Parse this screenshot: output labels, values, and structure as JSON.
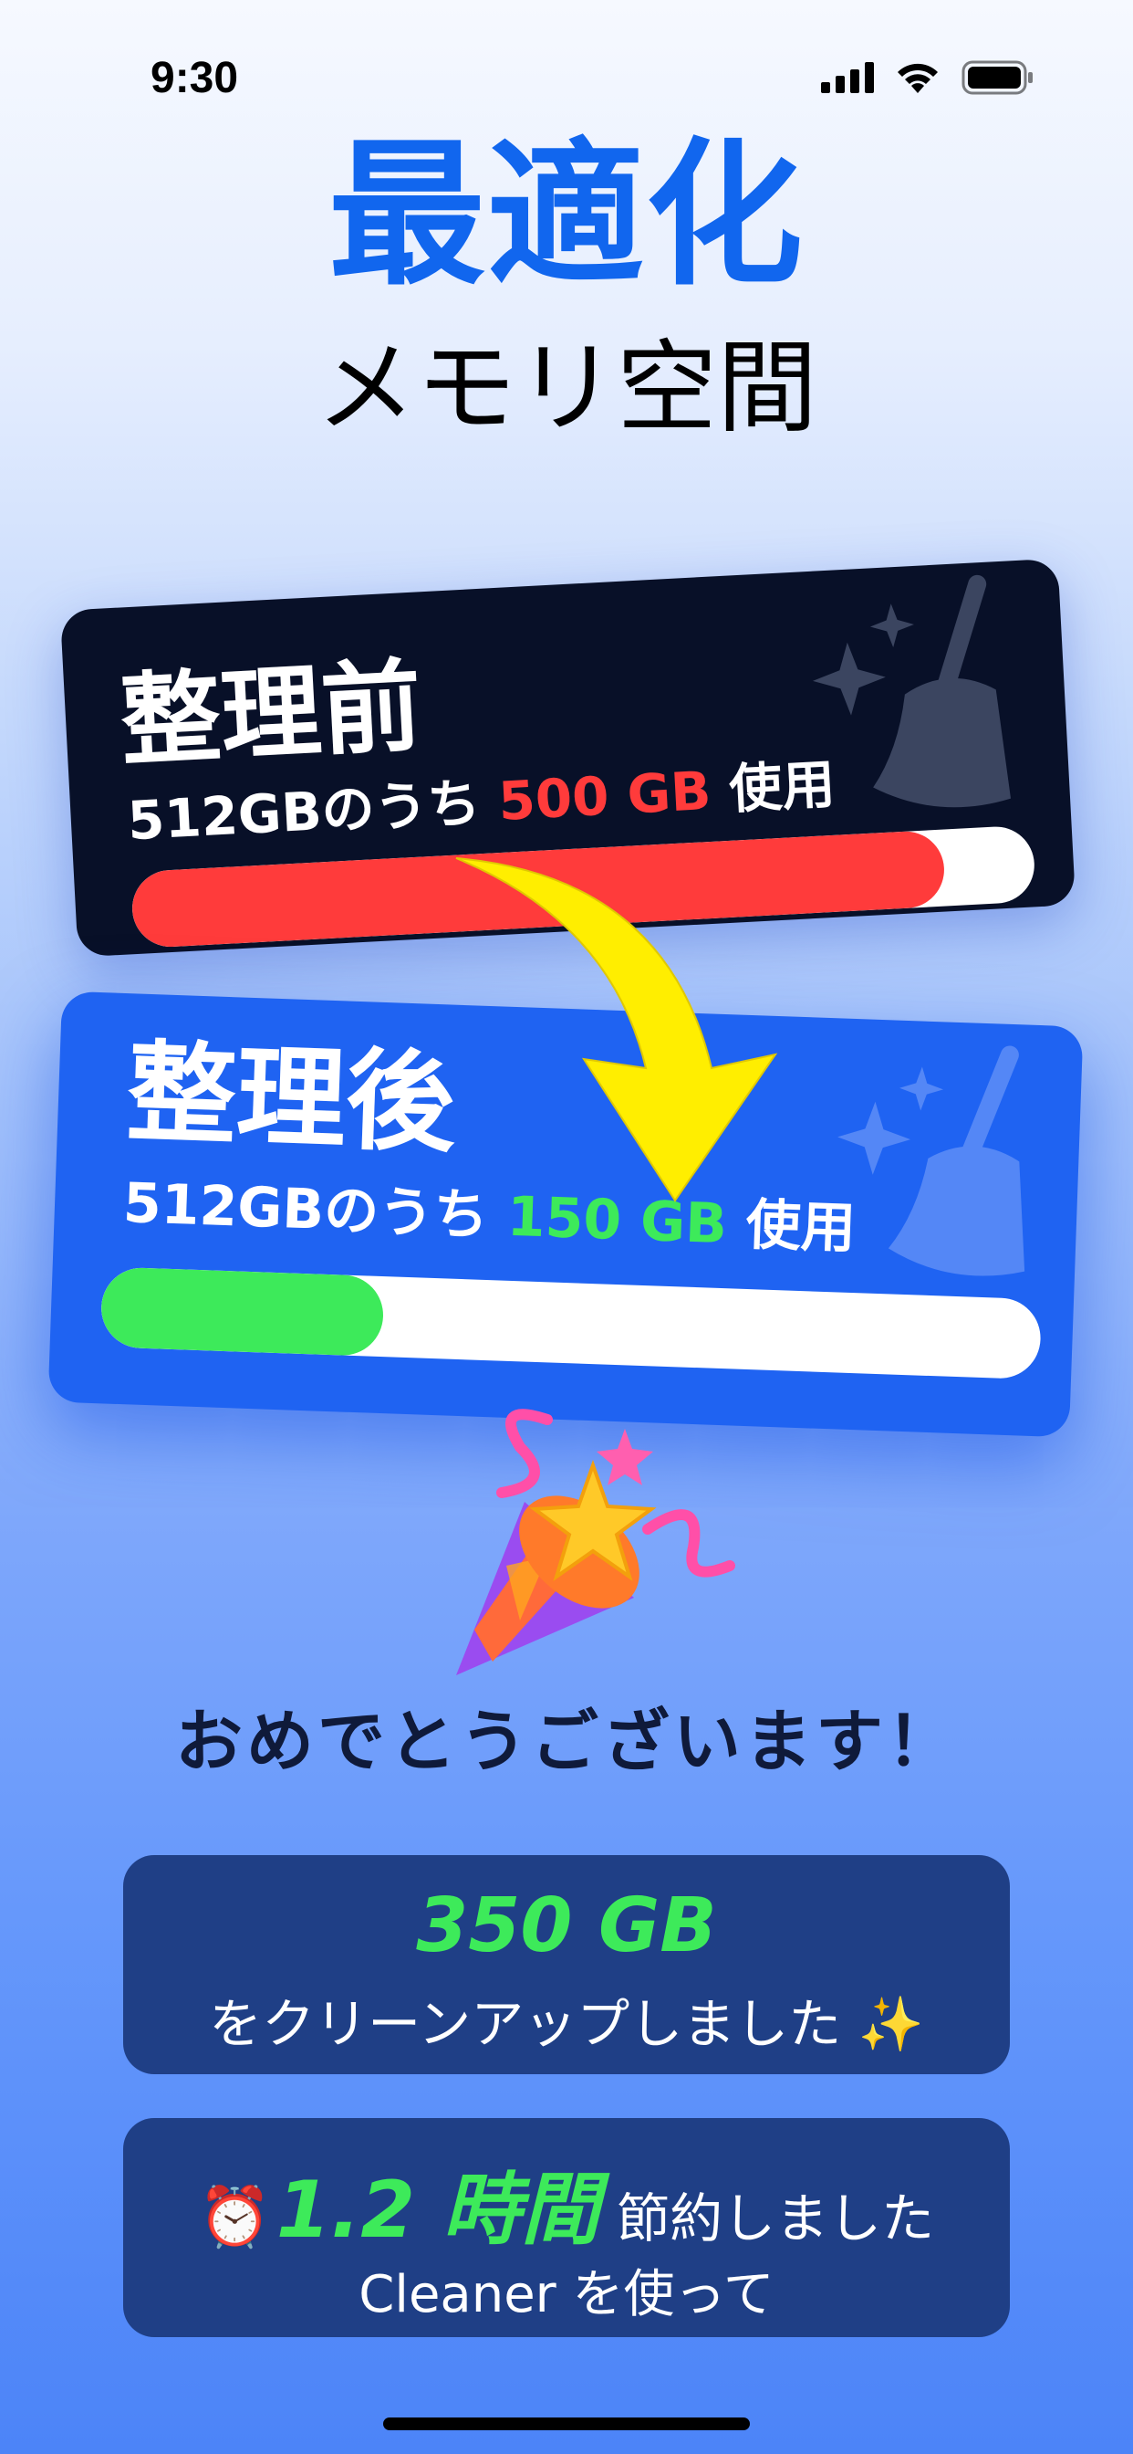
{
  "status_bar": {
    "time": "9:30"
  },
  "header": {
    "title": "最適化",
    "subtitle": "メモリ空間"
  },
  "before_card": {
    "heading": "整理前",
    "usage_prefix": "512GBのうち ",
    "usage_value": "500 GB",
    "usage_suffix": " 使用",
    "used_fraction": 0.9,
    "bar_color": "#ff3b3b",
    "background_color": "#081028",
    "icon": "broom-icon"
  },
  "after_card": {
    "heading": "整理後",
    "usage_prefix": "512GBのうち ",
    "usage_value": "150 GB",
    "usage_suffix": " 使用",
    "used_fraction": 0.3,
    "bar_color": "#3dea5a",
    "background_color": "#1f63f2",
    "icon": "broom-icon"
  },
  "arrow": {
    "icon": "curved-arrow-icon",
    "color": "#ffee00"
  },
  "celebration": {
    "icon": "party-popper-icon",
    "message": "おめでとうございます！"
  },
  "stats": {
    "cleaned_value": "350 GB",
    "cleaned_text": "をクリーンアップしました ✨",
    "saved_icon": "⏰",
    "saved_value": "1.2 時間",
    "saved_label": "節約しました",
    "saved_subtext": "Cleaner を使って"
  },
  "colors": {
    "accent": "#1166ee",
    "highlight_green": "#3dea5a",
    "alert_red": "#ff3b3b",
    "stat_box": "#1f3f86"
  }
}
